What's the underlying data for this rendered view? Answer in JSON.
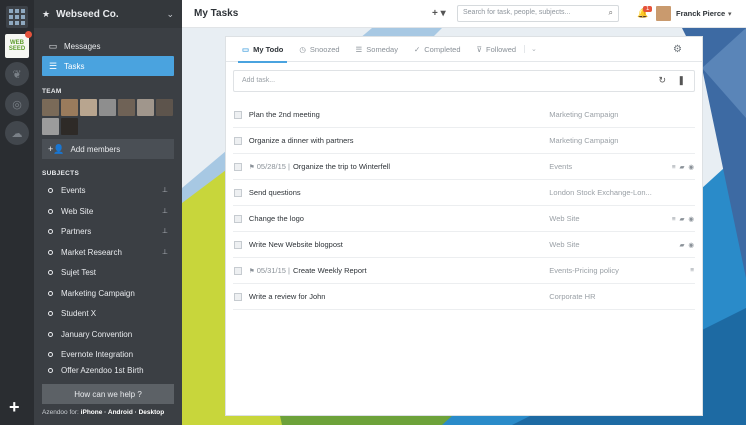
{
  "workspace": {
    "name": "Webseed Co.",
    "rail_badge_logo": "WEB SEED"
  },
  "nav": [
    {
      "label": "Messages",
      "icon": "message-icon"
    },
    {
      "label": "Tasks",
      "icon": "tasks-icon",
      "active": true
    }
  ],
  "team": {
    "label": "TEAM",
    "add_members": "Add members"
  },
  "subjects": {
    "label": "SUBJECTS",
    "items": [
      {
        "label": "Events",
        "pinned": true
      },
      {
        "label": "Web Site",
        "pinned": true
      },
      {
        "label": "Partners",
        "pinned": true
      },
      {
        "label": "Market Research",
        "pinned": true
      },
      {
        "label": "Sujet Test",
        "pinned": false
      },
      {
        "label": "Marketing Campaign",
        "pinned": false
      },
      {
        "label": "Student X",
        "pinned": false
      },
      {
        "label": "January Convention",
        "pinned": false
      },
      {
        "label": "Evernote Integration",
        "pinned": false
      },
      {
        "label": "Offer Azendoo 1st Birth",
        "pinned": false
      }
    ]
  },
  "help": {
    "button": "How can we help ?",
    "apps_prefix": "Azendoo for:",
    "apps": "iPhone · Android · Desktop"
  },
  "header": {
    "title": "My Tasks",
    "quick_add": "+ ▾",
    "search_placeholder": "Search for task, people, subjects...",
    "notifications": "1",
    "user_name": "Franck Pierce"
  },
  "tabs": [
    {
      "label": "My Todo",
      "icon": "inbox-icon",
      "active": true
    },
    {
      "label": "Snoozed",
      "icon": "clock-icon"
    },
    {
      "label": "Someday",
      "icon": "list-icon"
    },
    {
      "label": "Completed",
      "icon": "check-icon"
    },
    {
      "label": "Followed",
      "icon": "filter-icon"
    }
  ],
  "add_task_placeholder": "Add task...",
  "tasks": [
    {
      "title": "Plan the 2nd meeting",
      "due": "",
      "subject": "Marketing Campaign",
      "meta": ""
    },
    {
      "title": "Organize a dinner with partners",
      "due": "",
      "subject": "Marketing Campaign",
      "meta": ""
    },
    {
      "title": "Organize the trip to Winterfell",
      "due": "05/28/15 |",
      "subject": "Events",
      "meta": "≡ ▰ ◉"
    },
    {
      "title": "Send questions",
      "due": "",
      "subject": "London Stock Exchange-Lon...",
      "meta": ""
    },
    {
      "title": "Change the logo",
      "due": "",
      "subject": "Web Site",
      "meta": "≡ ▰ ◉"
    },
    {
      "title": "Write New Website blogpost",
      "due": "",
      "subject": "Web Site",
      "meta": "▰ ◉"
    },
    {
      "title": "Create Weekly Report",
      "due": "05/31/15 |",
      "subject": "Events-Pricing policy",
      "meta": "≡"
    },
    {
      "title": "Write a review for John",
      "due": "",
      "subject": "Corporate HR",
      "meta": ""
    }
  ],
  "colors": {
    "accent": "#4aa3df",
    "sidebar": "#3b3f44",
    "rail": "#2a2d31",
    "badge": "#e5533c"
  }
}
